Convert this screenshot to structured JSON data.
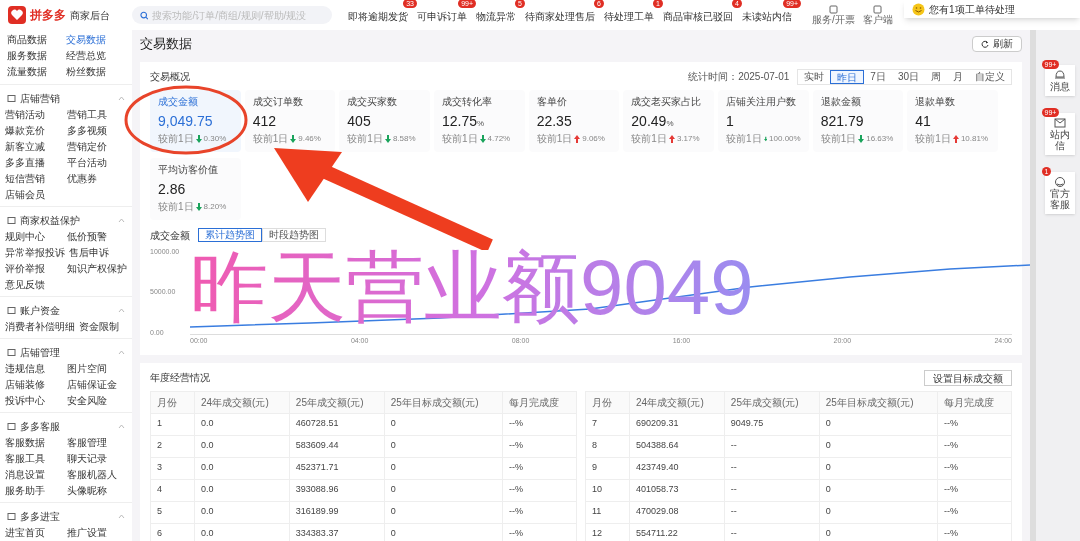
{
  "brand": {
    "logo": "拼多多",
    "subtitle": "商家后台"
  },
  "search": {
    "placeholder": "搜索功能/订单/商组/规则/帮助/规没"
  },
  "top_links": [
    {
      "label": "即将逾期发货",
      "badge": "33"
    },
    {
      "label": "可申诉订单",
      "badge": "99+"
    },
    {
      "label": "物流异常",
      "badge": "5"
    },
    {
      "label": "待商家处理售后",
      "badge": "6"
    },
    {
      "label": "待处理工单",
      "badge": "1"
    },
    {
      "label": "商品审核已驳回",
      "badge": "4"
    },
    {
      "label": "未读站内信",
      "badge": "99+"
    }
  ],
  "top_tools": [
    "服务/开票",
    "客户端"
  ],
  "notification": {
    "text": "您有1项工单待处理"
  },
  "sidebar": {
    "top_items": [
      {
        "label": "商品数据",
        "selected": false
      },
      {
        "label": "交易数据",
        "selected": true
      },
      {
        "label": "服务数据",
        "selected": false
      },
      {
        "label": "经营总览",
        "selected": false
      },
      {
        "label": "流量数据",
        "selected": false
      },
      {
        "label": "粉丝数据",
        "selected": false
      }
    ],
    "groups": [
      {
        "title": "店铺营销",
        "items": [
          "营销活动",
          "营销工具",
          "爆款竞价",
          "多多视频",
          "新客立减",
          "营销定价",
          "多多直播",
          "平台活动",
          "短信营销",
          "优惠券",
          "店铺会员"
        ]
      },
      {
        "title": "商家权益保护",
        "items": [
          "规则中心",
          "低价预警",
          "异常举报投诉",
          "售后申诉",
          "评价举报",
          "知识产权保护",
          "意见反馈"
        ]
      },
      {
        "title": "账户资金",
        "items": [
          "消费者补偿明细",
          "资金限制"
        ]
      },
      {
        "title": "店铺管理",
        "items": [
          "违规信息",
          "图片空间",
          "店铺装修",
          "店铺保证金",
          "投诉中心",
          "安全风险"
        ]
      },
      {
        "title": "多多客服",
        "items": [
          "客服数据",
          "客服管理",
          "客服工具",
          "聊天记录",
          "消息设置",
          "客服机器人",
          "服务助手",
          "头像昵称"
        ]
      },
      {
        "title": "多多进宝",
        "items": [
          "进宝首页",
          "推广设置"
        ]
      }
    ]
  },
  "page_title": "交易数据",
  "refresh_button": "刷新",
  "overview": {
    "title": "交易概况",
    "stat_time": "统计时间：2025-07-01",
    "ranges": [
      {
        "label": "实时",
        "selected": false
      },
      {
        "label": "昨日",
        "selected": true
      },
      {
        "label": "7日",
        "selected": false
      },
      {
        "label": "30日",
        "selected": false
      },
      {
        "label": "周",
        "selected": false
      },
      {
        "label": "月",
        "selected": false
      },
      {
        "label": "自定义",
        "selected": false
      }
    ],
    "metrics": [
      {
        "label": "成交金额",
        "value": "9,049.75",
        "compare": "较前1日",
        "rising": false,
        "change": "0.30%",
        "selected": true
      },
      {
        "label": "成交订单数",
        "value": "412",
        "compare": "较前1日",
        "rising": false,
        "change": "9.46%",
        "selected": false
      },
      {
        "label": "成交买家数",
        "value": "405",
        "compare": "较前1日",
        "rising": false,
        "change": "8.58%",
        "selected": false
      },
      {
        "label": "成交转化率",
        "value": "12.75",
        "unit": "%",
        "compare": "较前1日",
        "rising": false,
        "change": "4.72%",
        "selected": false
      },
      {
        "label": "客单价",
        "value": "22.35",
        "compare": "较前1日",
        "rising": true,
        "change": "9.06%",
        "selected": false
      },
      {
        "label": "成交老买家占比",
        "value": "20.49",
        "unit": "%",
        "compare": "较前1日",
        "rising": true,
        "change": "3.17%",
        "selected": false
      },
      {
        "label": "店铺关注用户数",
        "value": "1",
        "compare": "较前1日",
        "rising": false,
        "change": "100.00%",
        "selected": false
      },
      {
        "label": "退款金额",
        "value": "821.79",
        "compare": "较前1日",
        "rising": false,
        "change": "16.63%",
        "selected": false
      },
      {
        "label": "退款单数",
        "value": "41",
        "compare": "较前1日",
        "rising": true,
        "change": "10.81%",
        "selected": false
      },
      {
        "label": "平均访客价值",
        "value": "2.86",
        "compare": "较前1日",
        "rising": false,
        "change": "8.20%",
        "selected": false
      }
    ]
  },
  "trend": {
    "label": "成交金额",
    "views": [
      {
        "label": "累计趋势图",
        "selected": true
      },
      {
        "label": "时段趋势图",
        "selected": false
      }
    ],
    "y_ticks": [
      "10000.00",
      "5000.00",
      "0.00"
    ],
    "x_ticks": [
      "00:00",
      "04:00",
      "08:00",
      "16:00",
      "20:00",
      "24:00"
    ]
  },
  "annual": {
    "title": "年度经营情况",
    "button": "设置目标成交额",
    "left_columns": [
      "月份",
      "24年成交额(元)",
      "25年成交额(元)",
      "25年目标成交额(元)",
      "每月完成度"
    ],
    "right_columns": [
      "月份",
      "24年成交额(元)",
      "25年成交额(元)",
      "25年目标成交额(元)",
      "每月完成度"
    ],
    "left_rows": [
      [
        "1",
        "0.0",
        "460728.51",
        "0",
        "--%"
      ],
      [
        "2",
        "0.0",
        "583609.44",
        "0",
        "--%"
      ],
      [
        "3",
        "0.0",
        "452371.71",
        "0",
        "--%"
      ],
      [
        "4",
        "0.0",
        "393088.96",
        "0",
        "--%"
      ],
      [
        "5",
        "0.0",
        "316189.99",
        "0",
        "--%"
      ],
      [
        "6",
        "0.0",
        "334383.37",
        "0",
        "--%"
      ]
    ],
    "right_rows": [
      [
        "7",
        "690209.31",
        "9049.75",
        "0",
        "--%"
      ],
      [
        "8",
        "504388.64",
        "--",
        "0",
        "--%"
      ],
      [
        "9",
        "423749.40",
        "--",
        "0",
        "--%"
      ],
      [
        "10",
        "401058.73",
        "--",
        "0",
        "--%"
      ],
      [
        "11",
        "470029.08",
        "--",
        "0",
        "--%"
      ],
      [
        "12",
        "554711.22",
        "--",
        "0",
        "--%"
      ]
    ]
  },
  "side_panel": [
    {
      "label": "消息",
      "badge": "99+"
    },
    {
      "label": "站内信",
      "badge": "99+"
    },
    {
      "label": "官方客服",
      "badge": "1"
    }
  ],
  "annotation": {
    "text": "昨天营业额9049"
  }
}
